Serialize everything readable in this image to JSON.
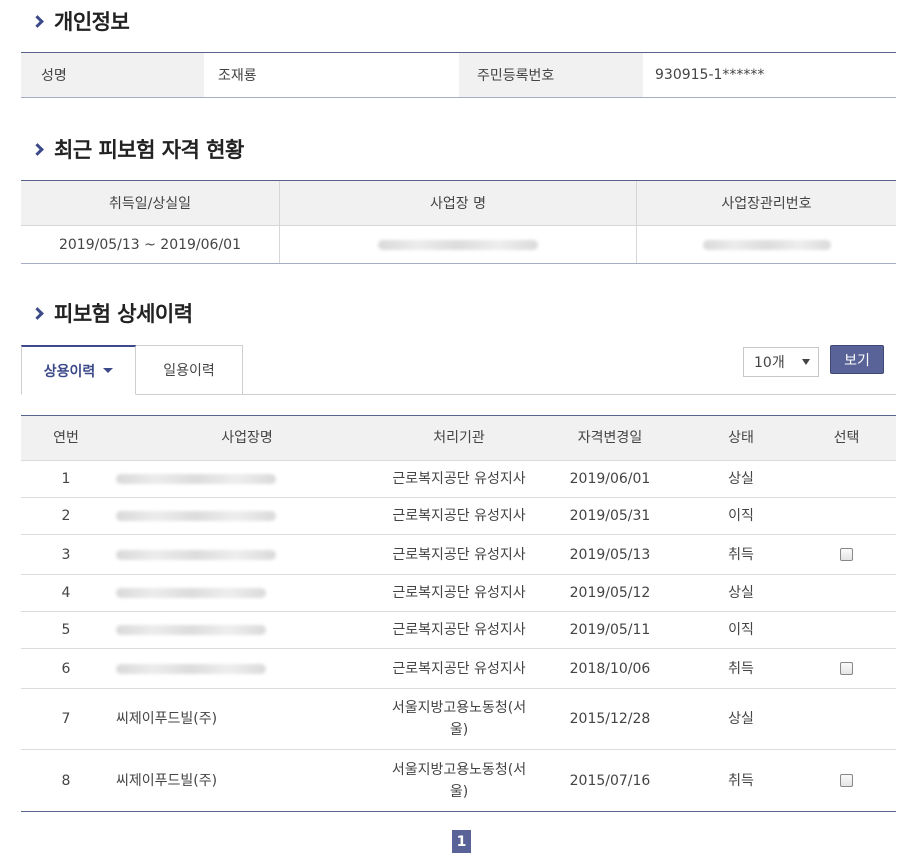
{
  "sections": {
    "personal": "개인정보",
    "recent": "최근 피보험 자격 현황",
    "detail": "피보험 상세이력"
  },
  "personal": {
    "name_label": "성명",
    "name_value": "조재룡",
    "rrn_label": "주민등록번호",
    "rrn_value": "930915-1******"
  },
  "recent": {
    "headers": [
      "취득일/상실일",
      "사업장 명",
      "사업장관리번호"
    ],
    "row": {
      "period": "2019/05/13 ~ 2019/06/01"
    }
  },
  "tabs": {
    "regular": "상용이력",
    "daily": "일용이력"
  },
  "page_size": "10개",
  "view_button": "보기",
  "detail": {
    "headers": [
      "연번",
      "사업장명",
      "처리기관",
      "자격변경일",
      "상태",
      "선택"
    ],
    "rows": [
      {
        "no": "1",
        "company": "",
        "agency": "근로복지공단 유성지사",
        "date": "2019/06/01",
        "status": "상실",
        "checkbox": false
      },
      {
        "no": "2",
        "company": "",
        "agency": "근로복지공단 유성지사",
        "date": "2019/05/31",
        "status": "이직",
        "checkbox": false
      },
      {
        "no": "3",
        "company": "",
        "agency": "근로복지공단 유성지사",
        "date": "2019/05/13",
        "status": "취득",
        "checkbox": true
      },
      {
        "no": "4",
        "company": "",
        "agency": "근로복지공단 유성지사",
        "date": "2019/05/12",
        "status": "상실",
        "checkbox": false
      },
      {
        "no": "5",
        "company": "",
        "agency": "근로복지공단 유성지사",
        "date": "2019/05/11",
        "status": "이직",
        "checkbox": false
      },
      {
        "no": "6",
        "company": "",
        "agency": "근로복지공단 유성지사",
        "date": "2018/10/06",
        "status": "취득",
        "checkbox": true
      },
      {
        "no": "7",
        "company": "씨제이푸드빌(주)",
        "agency_line1": "서울지방고용노동청(서",
        "agency_line2": "울)",
        "date": "2015/12/28",
        "status": "상실",
        "checkbox": false
      },
      {
        "no": "8",
        "company": "씨제이푸드빌(주)",
        "agency_line1": "서울지방고용노동청(서",
        "agency_line2": "울)",
        "date": "2015/07/16",
        "status": "취득",
        "checkbox": true
      }
    ]
  },
  "pagination": {
    "current": "1"
  }
}
